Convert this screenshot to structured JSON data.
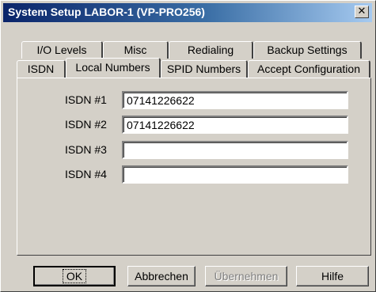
{
  "window": {
    "title": "System Setup  LABOR-1 (VP-PRO256)",
    "close_glyph": "✕"
  },
  "tabs_back": [
    {
      "label": "I/O Levels"
    },
    {
      "label": "Misc"
    },
    {
      "label": "Redialing"
    },
    {
      "label": "Backup Settings"
    }
  ],
  "tabs_front": [
    {
      "label": "ISDN"
    },
    {
      "label": "Local Numbers"
    },
    {
      "label": "SPID Numbers"
    },
    {
      "label": "Accept Configuration"
    }
  ],
  "active_tab": "Local Numbers",
  "fields": [
    {
      "label": "ISDN #1",
      "value": "07141226622"
    },
    {
      "label": "ISDN #2",
      "value": "07141226622"
    },
    {
      "label": "ISDN #3",
      "value": ""
    },
    {
      "label": "ISDN #4",
      "value": ""
    }
  ],
  "buttons": {
    "ok": "OK",
    "cancel": "Abbrechen",
    "apply": "Übernehmen",
    "help": "Hilfe"
  },
  "colors": {
    "dialog_bg": "#d4d0c8",
    "title_start": "#0a246a",
    "title_end": "#a6caf0"
  }
}
